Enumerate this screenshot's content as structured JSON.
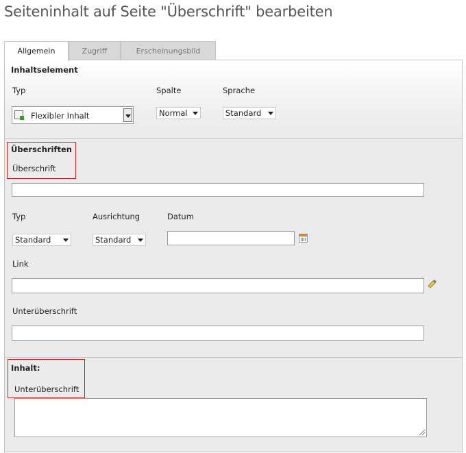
{
  "page": {
    "title": "Seiteninhalt auf Seite \"Überschrift\" bearbeiten"
  },
  "tabs": [
    {
      "label": "Allgemein",
      "active": true
    },
    {
      "label": "Zugriff",
      "active": false
    },
    {
      "label": "Erscheinungsbild",
      "active": false
    }
  ],
  "section_content_element": {
    "heading": "Inhaltselement",
    "type_label": "Typ",
    "type_value": "Flexibler Inhalt",
    "column_label": "Spalte",
    "column_value": "Normal",
    "language_label": "Sprache",
    "language_value": "Standard"
  },
  "section_headers": {
    "heading": "Überschriften",
    "header_label": "Überschrift",
    "header_value": "",
    "type_label": "Typ",
    "type_value": "Standard",
    "alignment_label": "Ausrichtung",
    "alignment_value": "Standard",
    "date_label": "Datum",
    "date_value": "",
    "link_label": "Link",
    "link_value": "",
    "subheader_label": "Unterüberschrift",
    "subheader_value": ""
  },
  "section_content": {
    "heading": "Inhalt:",
    "subheader_label": "Unterüberschrift",
    "text_value": ""
  },
  "colors": {
    "highlight_border": "#cc2222",
    "section_bg": "#ebebeb"
  }
}
